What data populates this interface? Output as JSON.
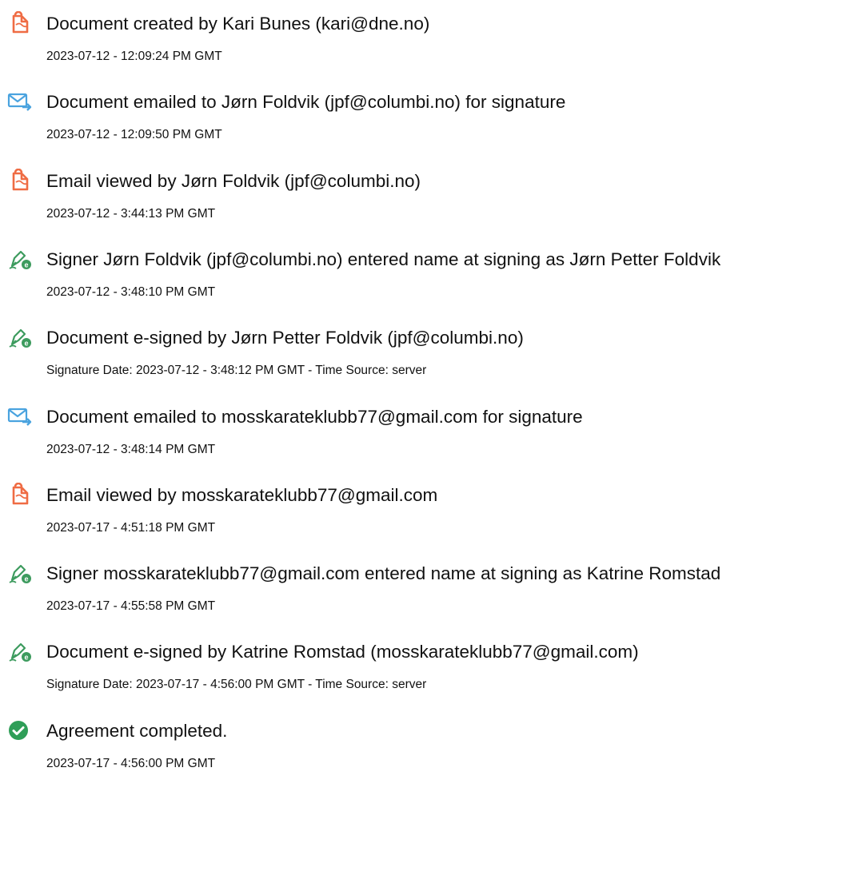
{
  "events": [
    {
      "icon": "document-created-icon",
      "title": "Document created by Kari Bunes (kari@dne.no)",
      "timestamp": "2023-07-12 - 12:09:24 PM GMT"
    },
    {
      "icon": "email-sent-icon",
      "title": "Document emailed to Jørn Foldvik (jpf@columbi.no) for signature",
      "timestamp": "2023-07-12 - 12:09:50 PM GMT"
    },
    {
      "icon": "document-viewed-icon",
      "title": "Email viewed by Jørn Foldvik (jpf@columbi.no)",
      "timestamp": "2023-07-12 - 3:44:13 PM GMT"
    },
    {
      "icon": "pen-signature-icon",
      "title": "Signer Jørn Foldvik (jpf@columbi.no) entered name at signing as Jørn Petter Foldvik",
      "timestamp": "2023-07-12 - 3:48:10 PM GMT"
    },
    {
      "icon": "pen-signature-icon",
      "title": "Document e-signed by Jørn Petter Foldvik (jpf@columbi.no)",
      "timestamp": "Signature Date: 2023-07-12 - 3:48:12 PM GMT - Time Source: server"
    },
    {
      "icon": "email-sent-icon",
      "title": "Document emailed to mosskarateklubb77@gmail.com for signature",
      "timestamp": "2023-07-12 - 3:48:14 PM GMT"
    },
    {
      "icon": "document-viewed-icon",
      "title": "Email viewed by mosskarateklubb77@gmail.com",
      "timestamp": "2023-07-17 - 4:51:18 PM GMT"
    },
    {
      "icon": "pen-signature-icon",
      "title": "Signer mosskarateklubb77@gmail.com entered name at signing as Katrine Romstad",
      "timestamp": "2023-07-17 - 4:55:58 PM GMT"
    },
    {
      "icon": "pen-signature-icon",
      "title": "Document e-signed by Katrine Romstad (mosskarateklubb77@gmail.com)",
      "timestamp": "Signature Date: 2023-07-17 - 4:56:00 PM GMT - Time Source: server"
    },
    {
      "icon": "agreement-completed-icon",
      "title": "Agreement completed.",
      "timestamp": "2023-07-17 - 4:56:00 PM GMT"
    }
  ],
  "colors": {
    "document_icon": "#ef6c44",
    "email_icon": "#4aa3df",
    "pen_icon": "#3d9b5e",
    "check_icon": "#2f9e58"
  }
}
